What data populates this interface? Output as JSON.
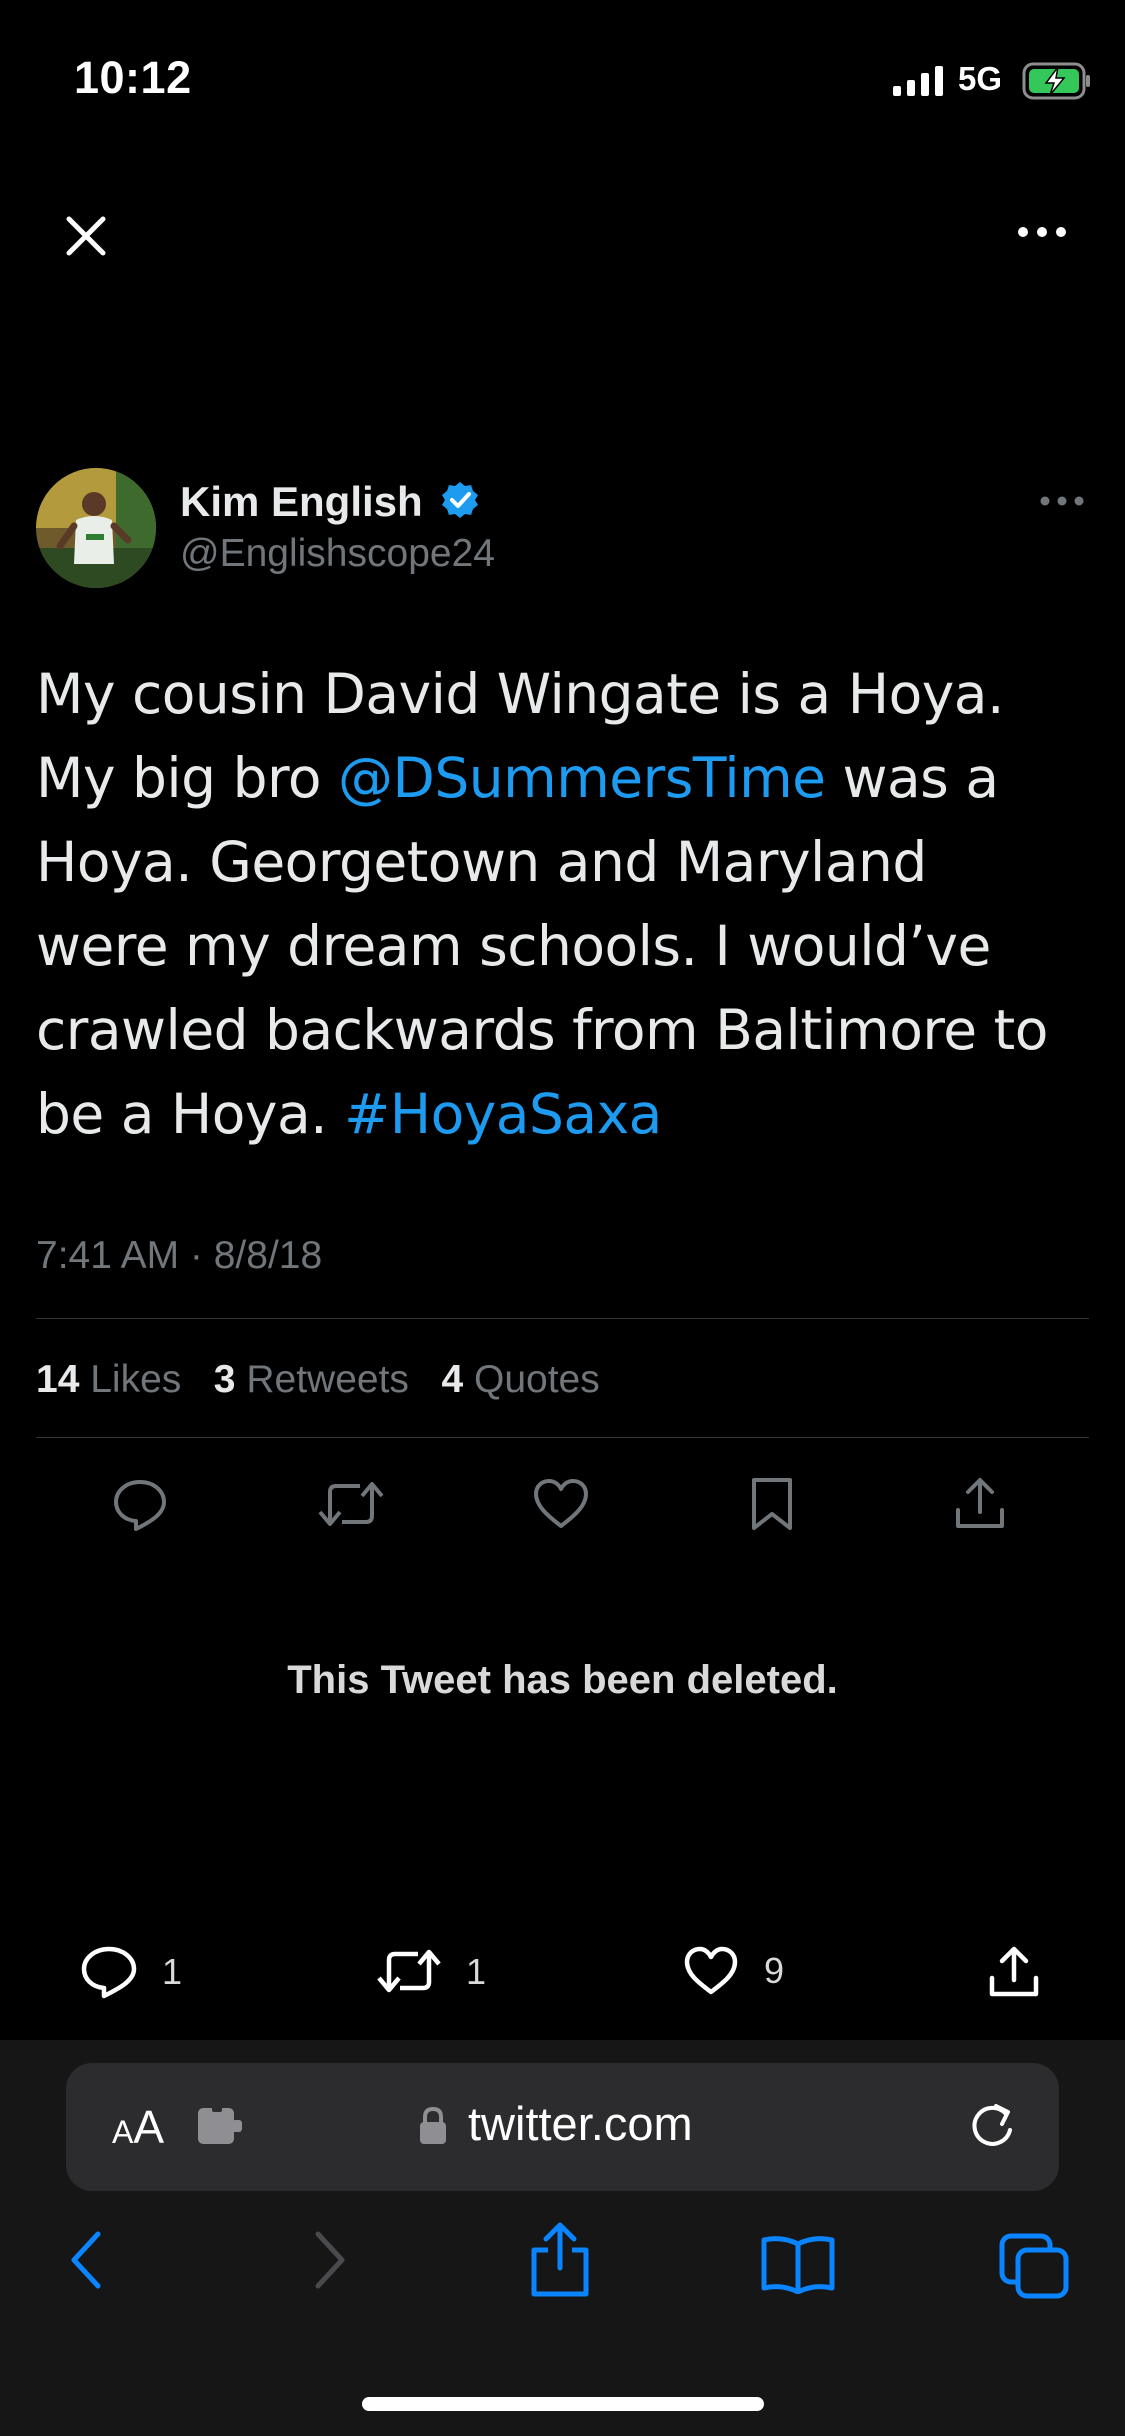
{
  "status_bar": {
    "time": "10:12",
    "network": "5G"
  },
  "author": {
    "name": "Kim English",
    "handle": "@Englishscope24"
  },
  "tweet": {
    "lines": [
      [
        "My cousin David Wingate is a Hoya."
      ],
      [
        "My big bro ",
        "@DSummersTime",
        " was a"
      ],
      [
        "Hoya. Georgetown and Maryland"
      ],
      [
        "were my dream schools. I would’ve"
      ],
      [
        "crawled backwards from Baltimore to"
      ],
      [
        "be a Hoya. ",
        "#HoyaSaxa"
      ]
    ],
    "timestamp": "7:41 AM · 8/8/18"
  },
  "stats": {
    "likes_count": "14",
    "likes_label": "Likes",
    "retweets_count": "3",
    "retweets_label": "Retweets",
    "quotes_count": "4",
    "quotes_label": "Quotes"
  },
  "deleted_notice": "This Tweet has been deleted.",
  "bottom_bar": {
    "replies": "1",
    "retweets": "1",
    "likes": "9"
  },
  "browser": {
    "aa_small": "A",
    "aa_large": "A",
    "url": "twitter.com"
  },
  "colors": {
    "background": "#000000",
    "link": "#1d9bf0",
    "safari_accent": "#0a84ff",
    "verified": "#1d9bf0"
  },
  "icons": [
    "signal-icon",
    "battery-charging-icon",
    "close-icon",
    "more-icon",
    "verified-badge-icon",
    "reply-icon",
    "retweet-icon",
    "like-icon",
    "bookmark-icon",
    "share-icon",
    "extension-icon",
    "lock-icon",
    "reload-icon",
    "back-icon",
    "forward-icon",
    "safari-share-icon",
    "bookmarks-icon",
    "tabs-icon"
  ]
}
